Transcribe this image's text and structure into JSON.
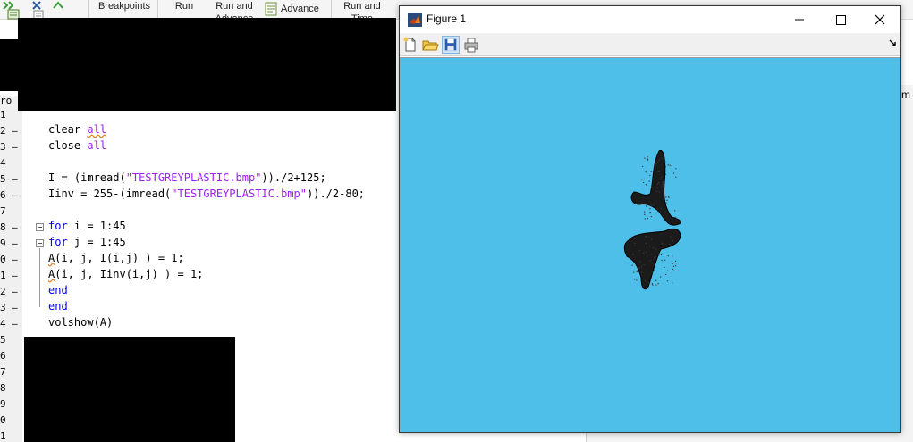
{
  "toolstrip": {
    "items": [
      "Breakpoints",
      "Run",
      "Run and Advance",
      "Advance",
      "Run and Time"
    ]
  },
  "editor": {
    "line_numbers": [
      "1",
      "2",
      "3",
      "4",
      "5",
      "6",
      "7",
      "8",
      "9",
      "0",
      "1",
      "2",
      "3",
      "4",
      "5",
      "6",
      "7",
      "8",
      "9",
      "0",
      "1"
    ],
    "breakpoint_mark": "–",
    "lines": {
      "l2": {
        "a": "clear ",
        "b": "all"
      },
      "l3": {
        "a": "close ",
        "b": "all"
      },
      "l5": {
        "a": "I = (imread(",
        "b": "\"TESTGREYPLASTIC.bmp\"",
        "c": "))./2+125;"
      },
      "l6": {
        "a": "Iinv = 255-(imread(",
        "b": "\"TESTGREYPLASTIC.bmp\"",
        "c": "))./2-80;"
      },
      "l8": {
        "k": "for",
        "a": " i = 1:45"
      },
      "l9": {
        "k": "for",
        "a": " j = 1:45"
      },
      "l10": {
        "a": "A",
        "b": "(i, j, I(i,j) ) = 1;"
      },
      "l11": {
        "a": "A",
        "b": "(i, j, Iinv(i,j) ) = 1;"
      },
      "l12": {
        "k": "end"
      },
      "l13": {
        "k": "end"
      },
      "l14": {
        "a": "volshow(A)"
      }
    }
  },
  "figure": {
    "title": "Figure 1",
    "canvas_color": "#4dbfe9",
    "shape_color": "#1b1b1b"
  },
  "right_panel": {
    "edge_text": "m"
  }
}
